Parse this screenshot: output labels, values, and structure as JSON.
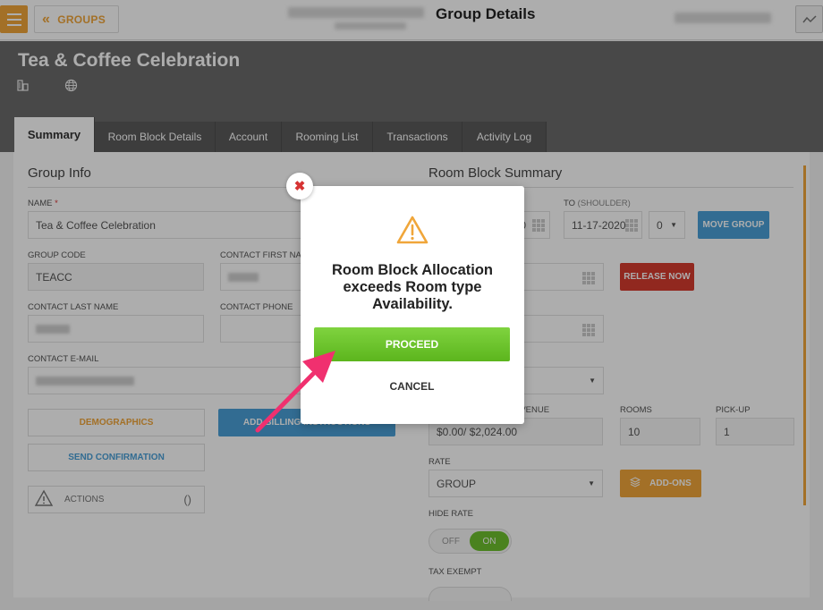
{
  "topbar": {
    "back_label": "GROUPS",
    "title": "Group Details"
  },
  "header": {
    "group_name": "Tea & Coffee Celebration"
  },
  "tabs": [
    {
      "label": "Summary",
      "active": true
    },
    {
      "label": "Room Block Details"
    },
    {
      "label": "Account"
    },
    {
      "label": "Rooming List"
    },
    {
      "label": "Transactions"
    },
    {
      "label": "Activity Log"
    }
  ],
  "group_info": {
    "title": "Group Info",
    "name_label": "NAME",
    "required_mark": "*",
    "name_value": "Tea & Coffee Celebration",
    "group_code_label": "GROUP CODE",
    "group_code_value": "TEACC",
    "contact_first_name_label": "CONTACT FIRST NAME",
    "contact_last_name_label": "CONTACT LAST NAME",
    "contact_phone_label": "CONTACT PHONE",
    "contact_email_label": "CONTACT E-MAIL",
    "demographics_label": "DEMOGRAPHICS",
    "add_billing_label": "ADD BILLING INSTRUCTIONS",
    "send_confirmation_label": "SEND CONFIRMATION",
    "actions_label": "ACTIONS",
    "actions_count": "()"
  },
  "room_block": {
    "title": "Room Block Summary",
    "to_label": "TO",
    "to_sub": "(SHOULDER)",
    "from_date_fragment": "0",
    "to_date": "11-17-2020",
    "shoulder_value": "0",
    "move_group_label": "MOVE GROUP",
    "release_now_label": "RELEASE NOW",
    "revenue_label": "EVENUE",
    "revenue_value": "$0.00/ $2,024.00",
    "rooms_label": "ROOMS",
    "rooms_value": "10",
    "pickup_label": "PICK-UP",
    "pickup_value": "1",
    "rate_label": "RATE",
    "rate_value": "GROUP",
    "addons_label": "ADD-ONS",
    "hide_rate_label": "HIDE RATE",
    "toggle_off": "OFF",
    "toggle_on": "ON",
    "tax_exempt_label": "TAX EXEMPT"
  },
  "modal": {
    "message": "Room Block Allocation exceeds Room type Availability.",
    "proceed_label": "PROCEED",
    "cancel_label": "CANCEL"
  },
  "colors": {
    "accent": "#f0a63a",
    "header": "#6b6b6b",
    "proceed": "#6ec02f",
    "release": "#d63b2f",
    "move": "#4aa0d8",
    "annotation_arrow": "#f0306f"
  }
}
